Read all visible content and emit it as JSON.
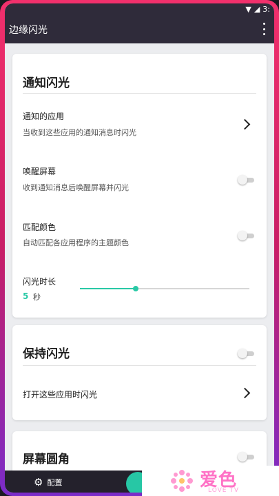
{
  "statusbar": {
    "battery_text": "3:"
  },
  "appbar": {
    "title": "边缘闪光"
  },
  "notification_section": {
    "title": "通知闪光",
    "rows": [
      {
        "title": "通知的应用",
        "subtitle": "当收到这些应用的通知消息时闪光",
        "control": "chevron"
      },
      {
        "title": "唤醒屏幕",
        "subtitle": "收到通知消息后唤醒屏幕并闪光",
        "control": "toggle",
        "on": false
      },
      {
        "title": "匹配颜色",
        "subtitle": "自动匹配各应用程序的主题颜色",
        "control": "toggle",
        "on": false
      }
    ],
    "duration": {
      "label": "闪光时长",
      "value": "5",
      "unit": "秒",
      "slider_fraction": 0.33
    }
  },
  "keep_section": {
    "title": "保持闪光",
    "toggle_on": false,
    "row_label": "打开这些应用时闪光"
  },
  "corner_section": {
    "title": "屏幕圆角",
    "toggle_on": false
  },
  "bottom_nav": {
    "config_label": "配置"
  },
  "watermark": {
    "text": "爱色",
    "sub": "LOVE TV"
  },
  "colors": {
    "accent": "#29c9a6",
    "appbar": "#2f2b3a",
    "frame": "#e0276a"
  }
}
